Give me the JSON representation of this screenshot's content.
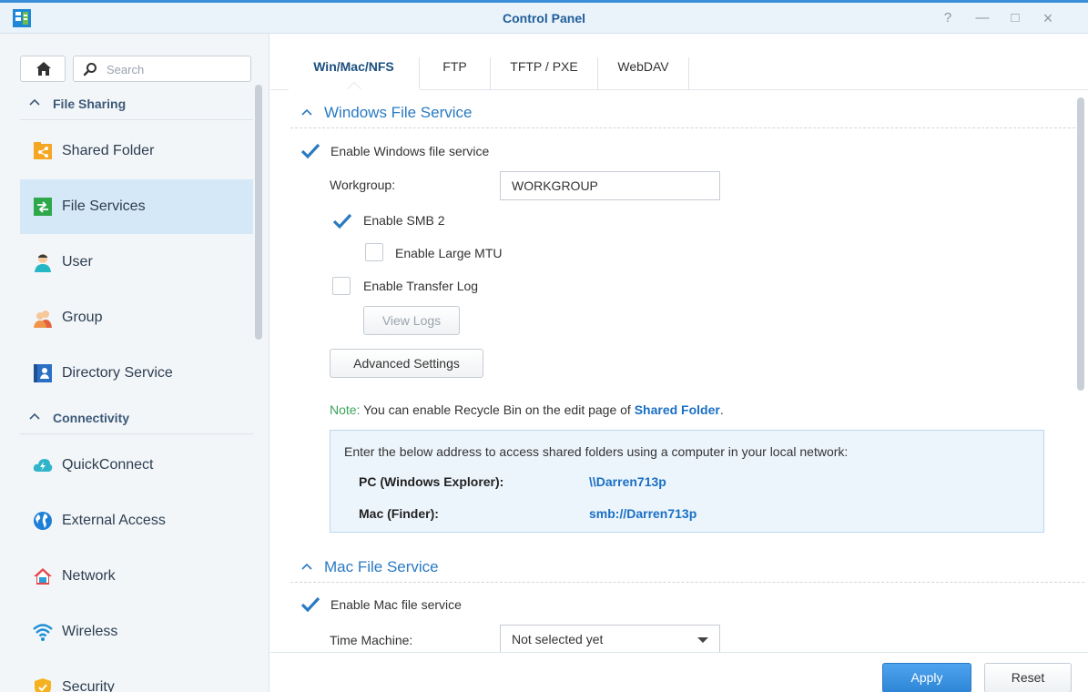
{
  "window": {
    "title": "Control Panel",
    "controls": {
      "help": "?",
      "minimize": "—",
      "maximize": "□",
      "close": "×"
    }
  },
  "sidebar": {
    "search_placeholder": "Search",
    "groups": [
      {
        "label": "File Sharing"
      },
      {
        "label": "Connectivity"
      }
    ],
    "items": [
      {
        "label": "Shared Folder",
        "icon": "shared-folder-icon"
      },
      {
        "label": "File Services",
        "icon": "file-services-icon",
        "active": true
      },
      {
        "label": "User",
        "icon": "user-icon"
      },
      {
        "label": "Group",
        "icon": "group-icon"
      },
      {
        "label": "Directory Service",
        "icon": "directory-service-icon"
      },
      {
        "label": "QuickConnect",
        "icon": "quickconnect-icon"
      },
      {
        "label": "External Access",
        "icon": "globe-icon"
      },
      {
        "label": "Network",
        "icon": "house-network-icon"
      },
      {
        "label": "Wireless",
        "icon": "wifi-icon"
      },
      {
        "label": "Security",
        "icon": "shield-icon"
      }
    ]
  },
  "tabs": [
    {
      "label": "Win/Mac/NFS",
      "active": true
    },
    {
      "label": "FTP"
    },
    {
      "label": "TFTP / PXE"
    },
    {
      "label": "WebDAV"
    }
  ],
  "windows_section": {
    "title": "Windows File Service",
    "enable_label": "Enable Windows file service",
    "enable_checked": true,
    "workgroup_label": "Workgroup:",
    "workgroup_value": "WORKGROUP",
    "smb2_label": "Enable SMB 2",
    "smb2_checked": true,
    "large_mtu_label": "Enable Large MTU",
    "large_mtu_checked": false,
    "transfer_log_label": "Enable Transfer Log",
    "transfer_log_checked": false,
    "view_logs_label": "View Logs",
    "advanced_label": "Advanced Settings",
    "note_prefix": "Note:",
    "note_text": " You can enable Recycle Bin on the edit page of ",
    "note_link": "Shared Folder",
    "note_suffix": ".",
    "info_intro": "Enter the below address to access shared folders using a computer in your local network:",
    "pc_label": "PC (Windows Explorer):",
    "pc_value": "\\\\Darren713p",
    "mac_label": "Mac (Finder):",
    "mac_value": "smb://Darren713p"
  },
  "mac_section": {
    "title": "Mac File Service",
    "enable_label": "Enable Mac file service",
    "enable_checked": true,
    "time_machine_label": "Time Machine:",
    "time_machine_value": "Not selected yet"
  },
  "footer": {
    "apply_label": "Apply",
    "reset_label": "Reset"
  },
  "colors": {
    "accent": "#2f86d6",
    "active_item": "#d5e8f8",
    "link": "#1a6fc4",
    "note": "#3aa55a"
  }
}
